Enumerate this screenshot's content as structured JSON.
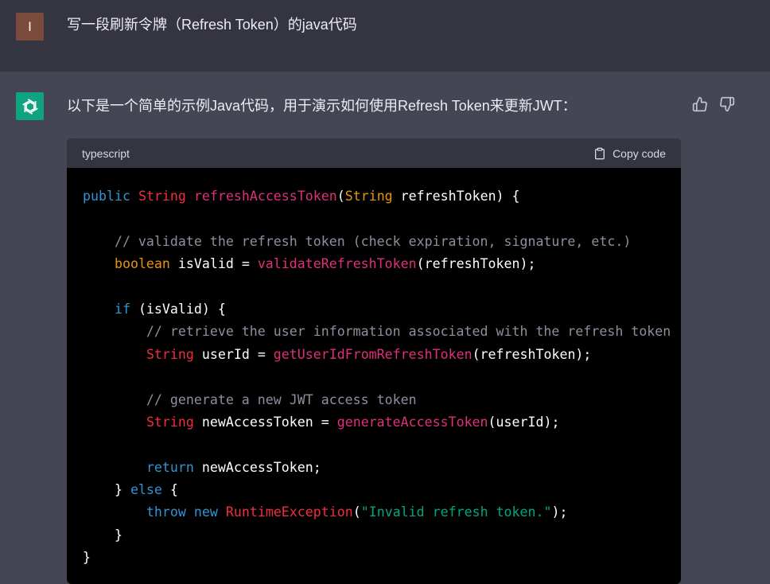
{
  "user_message": {
    "avatar_letter": "I",
    "text": "写一段刷新令牌（Refresh Token）的java代码"
  },
  "assistant_message": {
    "avatar_icon": "openai-logo-icon",
    "intro": "以下是一个简单的示例Java代码，用于演示如何使用Refresh Token来更新JWT：",
    "feedback": {
      "like_icon": "thumbs-up-icon",
      "dislike_icon": "thumbs-down-icon"
    }
  },
  "code_block": {
    "language": "typescript",
    "copy_label": "Copy code",
    "copy_icon": "clipboard-icon",
    "lines": [
      [
        {
          "t": "public",
          "c": "kw"
        },
        {
          "t": " ",
          "c": "plain"
        },
        {
          "t": "String",
          "c": "type"
        },
        {
          "t": " ",
          "c": "plain"
        },
        {
          "t": "refreshAccessToken",
          "c": "fn"
        },
        {
          "t": "(",
          "c": "plain"
        },
        {
          "t": "String",
          "c": "bool"
        },
        {
          "t": " refreshToken) {",
          "c": "plain"
        }
      ],
      [],
      [
        {
          "t": "    // validate the refresh token (check expiration, signature, etc.)",
          "c": "cmt"
        }
      ],
      [
        {
          "t": "    ",
          "c": "plain"
        },
        {
          "t": "boolean",
          "c": "bool"
        },
        {
          "t": " isValid = ",
          "c": "plain"
        },
        {
          "t": "validateRefreshToken",
          "c": "fn"
        },
        {
          "t": "(refreshToken);",
          "c": "plain"
        }
      ],
      [],
      [
        {
          "t": "    ",
          "c": "plain"
        },
        {
          "t": "if",
          "c": "kw"
        },
        {
          "t": " (isValid) {",
          "c": "plain"
        }
      ],
      [
        {
          "t": "        // retrieve the user information associated with the refresh token (",
          "c": "cmt"
        }
      ],
      [
        {
          "t": "        ",
          "c": "plain"
        },
        {
          "t": "String",
          "c": "type"
        },
        {
          "t": " userId = ",
          "c": "plain"
        },
        {
          "t": "getUserIdFromRefreshToken",
          "c": "fn"
        },
        {
          "t": "(refreshToken);",
          "c": "plain"
        }
      ],
      [],
      [
        {
          "t": "        // generate a new JWT access token",
          "c": "cmt"
        }
      ],
      [
        {
          "t": "        ",
          "c": "plain"
        },
        {
          "t": "String",
          "c": "type"
        },
        {
          "t": " newAccessToken = ",
          "c": "plain"
        },
        {
          "t": "generateAccessToken",
          "c": "fn"
        },
        {
          "t": "(userId);",
          "c": "plain"
        }
      ],
      [],
      [
        {
          "t": "        ",
          "c": "plain"
        },
        {
          "t": "return",
          "c": "kw"
        },
        {
          "t": " newAccessToken;",
          "c": "plain"
        }
      ],
      [
        {
          "t": "    } ",
          "c": "plain"
        },
        {
          "t": "else",
          "c": "kw"
        },
        {
          "t": " {",
          "c": "plain"
        }
      ],
      [
        {
          "t": "        ",
          "c": "plain"
        },
        {
          "t": "throw",
          "c": "kw"
        },
        {
          "t": " ",
          "c": "plain"
        },
        {
          "t": "new",
          "c": "kw"
        },
        {
          "t": " ",
          "c": "plain"
        },
        {
          "t": "RuntimeException",
          "c": "type"
        },
        {
          "t": "(",
          "c": "plain"
        },
        {
          "t": "\"Invalid refresh token.\"",
          "c": "str"
        },
        {
          "t": ");",
          "c": "plain"
        }
      ],
      [
        {
          "t": "    }",
          "c": "plain"
        }
      ],
      [
        {
          "t": "}",
          "c": "plain"
        }
      ]
    ]
  },
  "colors": {
    "user_row_bg": "#343541",
    "assistant_row_bg": "#444654",
    "user_avatar_bg": "#7a4a3c",
    "assistant_avatar_bg": "#10a37f",
    "code_bg": "#000000",
    "code_header_bg": "#343541"
  }
}
